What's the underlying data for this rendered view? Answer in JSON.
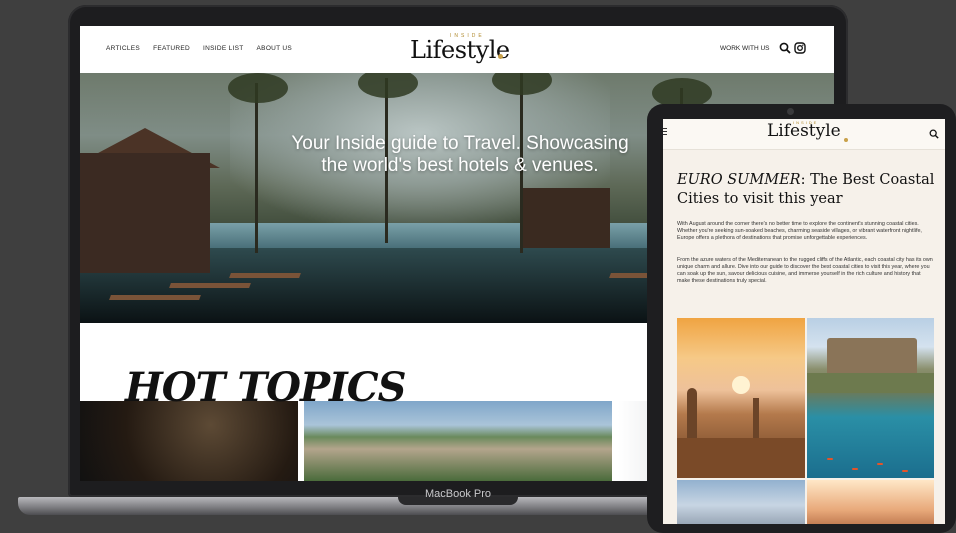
{
  "laptop": {
    "brand_label": "MacBook Pro",
    "site": {
      "nav": [
        "ARTICLES",
        "FEATURED",
        "INSIDE LIST",
        "ABOUT US"
      ],
      "logo_small": "INSIDE",
      "logo_word": "Lifestyle",
      "work_with_us": "WORK WITH US",
      "hero_line1": "Your Inside guide to Travel. Showcasing",
      "hero_line2": "the world's best hotels & venues.",
      "hot_topics": "HOT TOPICS"
    }
  },
  "tablet": {
    "logo_small": "INSIDE",
    "logo_word": "Lifestyle",
    "title_em": "EURO SUMMER",
    "title_rest": ": The Best Coastal Cities to visit this year",
    "para1": "With August around the corner there's no better time to explore the continent's stunning coastal cities. Whether you're seeking sun-soaked beaches, charming seaside villages, or vibrant waterfront nightlife, Europe offers a plethora of destinations that promise unforgettable experiences.",
    "para2": "From the azure waters of the Mediterranean to the rugged cliffs of the Atlantic, each coastal city has its own unique charm and allure. Dive into our guide to discover the best coastal cities to visit this year, where you can soak up the sun, savour delicious cuisine, and immerse yourself in the rich culture and history that make these destinations truly special."
  },
  "icons": {
    "search": "search-icon",
    "instagram": "instagram-icon",
    "menu": "menu-icon"
  }
}
